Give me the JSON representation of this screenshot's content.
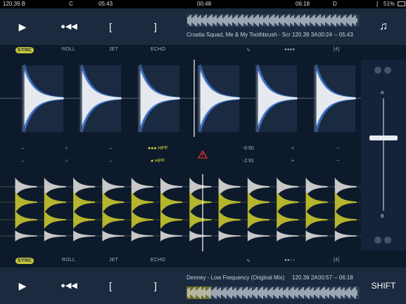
{
  "status": {
    "left_bpm": "120.39 B",
    "left_key": "C",
    "left_time": "05:43",
    "center_time": "00:48",
    "right_time": "06:18",
    "right_deck": "D",
    "battery": "51%"
  },
  "deck_top": {
    "play_icon": "▶",
    "cue_icon": "●◀◀",
    "loop_in": "[",
    "loop_out": "]",
    "track_title": "Croatia Squad, Me & My Toothbrush - Scr",
    "bpm_key": "120.39 3A",
    "time": "00:24 -- 05:43",
    "music_icon": "♫"
  },
  "fx_top": {
    "sync": "SYNC",
    "roll": "ROLL",
    "jet": "JET",
    "echo": "ECHO",
    "wave_icon": "∿",
    "dots": "●●●●",
    "beat": "[4]"
  },
  "eq": {
    "row1": {
      "hpf": "●●● HPF",
      "value": "-0.50",
      "plus": "+",
      "minus": "−"
    },
    "row2": {
      "hpf": "● HPF",
      "value": "-2.91",
      "plus": "+",
      "minus": "−"
    }
  },
  "fx_bottom": {
    "sync": "SYNC",
    "roll": "ROLL",
    "jet": "JET",
    "echo": "ECHO",
    "wave_icon": "∿",
    "dots": "●●○○",
    "beat": "[4]"
  },
  "deck_bottom": {
    "play_icon": "▶",
    "cue_icon": "●◀◀",
    "loop_in": "[",
    "loop_out": "]",
    "track_title": "Denney - Low Frequency (Original Mix)",
    "bpm_key": "120.39 2A",
    "time": "00:57 -- 06:18",
    "shift": "SHIFT"
  },
  "crossfader": {
    "label_a": "A",
    "label_b": "B",
    "position": 0.35
  },
  "colors": {
    "accent": "#c8c83a",
    "wave_blue": "#3b6fc4",
    "background": "#0d1a2b",
    "warning": "#e0322e"
  }
}
